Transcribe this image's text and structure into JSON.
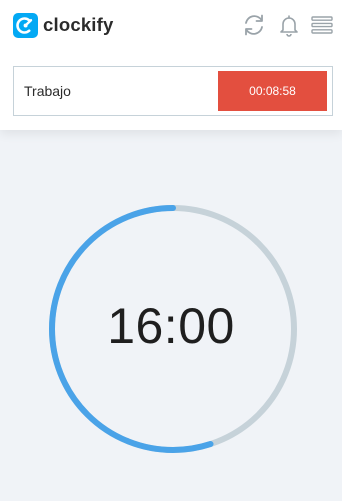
{
  "app": {
    "logo_text": "clockify",
    "brand_color": "#03a9f4"
  },
  "header": {
    "icons": [
      "sync-icon",
      "bell-icon",
      "hamburger-menu-icon"
    ]
  },
  "entry": {
    "description_value": "Trabajo",
    "timer_label": "00:08:58",
    "button_color": "#e34f3f"
  },
  "pomodoro": {
    "time_label": "16:00",
    "progress_fraction": 0.55,
    "progress_color": "#4aa3e8",
    "track_color": "#c6d2d9"
  }
}
